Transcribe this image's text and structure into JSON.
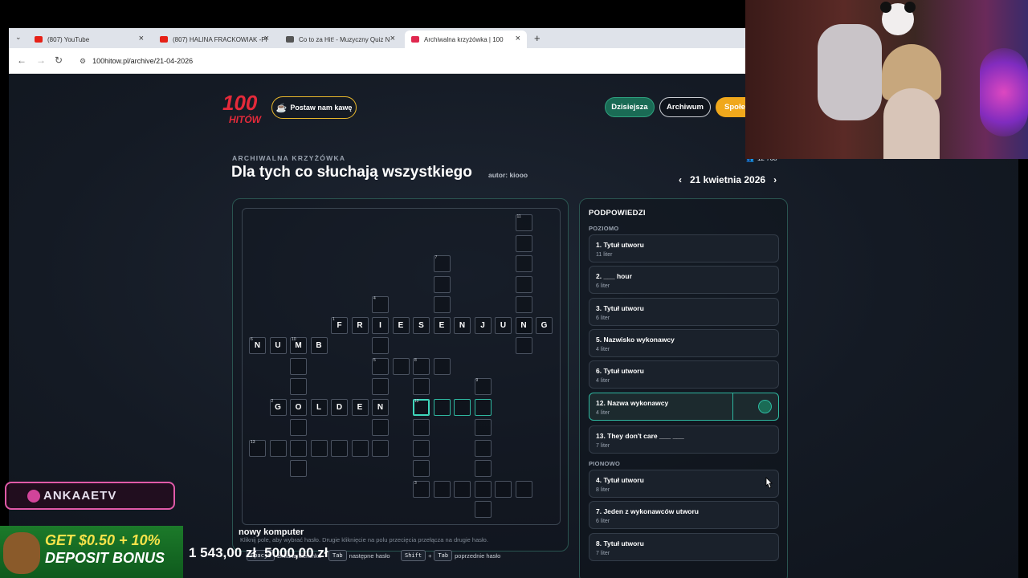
{
  "browser": {
    "tabs": [
      {
        "title": "(807) YouTube",
        "fav_color": "#e62117",
        "active": false
      },
      {
        "title": "(807) HALINA FRACKOWIAK -Pi",
        "fav_color": "#e62117",
        "active": false
      },
      {
        "title": "Co to za Hit! - Muzyczny Quiz N",
        "fav_color": "#555555",
        "active": false
      },
      {
        "title": "Archiwalna krzyżówka | 100",
        "fav_color": "#e0284f",
        "active": true
      }
    ],
    "url": "100hitow.pl/archive/21-04-2026"
  },
  "site": {
    "logo_text": "100 HITÓW",
    "coffee_button": "Postaw nam kawę",
    "nav": {
      "today": "Dzisiejsza",
      "archive": "Archiwum",
      "community": "Społe"
    },
    "kicker": "ARCHIWALNA KRZYŻÓWKA",
    "title": "Dla tych co słuchają wszystkiego",
    "author": "autor: kiooo",
    "date": "21 kwietnia 2026",
    "players_count": "12 768",
    "active_clue": "nowy komputer",
    "hint": "Kliknij pole, aby wybrać hasło. Drugie kliknięcie na polu przecięcia przełącza na drugie hasło.",
    "keyhelp": {
      "k1": "Spacja",
      "t1": "zmiana kierunku",
      "k2": "Tab",
      "t2": "następne hasło",
      "k3": "Shift",
      "plus": "+",
      "k4": "Tab",
      "t3": "poprzednie hasło"
    }
  },
  "crossword": {
    "cells": [
      {
        "r": 0,
        "c": 13,
        "n": "11"
      },
      {
        "r": 1,
        "c": 13
      },
      {
        "r": 2,
        "c": 13
      },
      {
        "r": 3,
        "c": 13
      },
      {
        "r": 4,
        "c": 13
      },
      {
        "r": 5,
        "c": 13
      },
      {
        "r": 2,
        "c": 9,
        "n": "7"
      },
      {
        "r": 3,
        "c": 9
      },
      {
        "r": 4,
        "c": 9
      },
      {
        "r": 4,
        "c": 6,
        "n": "4"
      },
      {
        "r": 5,
        "c": 4,
        "n": "1",
        "l": "F"
      },
      {
        "r": 5,
        "c": 5,
        "l": "R"
      },
      {
        "r": 5,
        "c": 6,
        "l": "I"
      },
      {
        "r": 5,
        "c": 7,
        "l": "E"
      },
      {
        "r": 5,
        "c": 8,
        "l": "S"
      },
      {
        "r": 5,
        "c": 9,
        "l": "E"
      },
      {
        "r": 5,
        "c": 10,
        "l": "N"
      },
      {
        "r": 5,
        "c": 11,
        "l": "J"
      },
      {
        "r": 5,
        "c": 12,
        "l": "U"
      },
      {
        "r": 5,
        "c": 13,
        "l": "N"
      },
      {
        "r": 5,
        "c": 14,
        "l": "G"
      },
      {
        "r": 6,
        "c": 0,
        "n": "6",
        "l": "N"
      },
      {
        "r": 6,
        "c": 1,
        "l": "U"
      },
      {
        "r": 6,
        "c": 2,
        "n": "10",
        "l": "M"
      },
      {
        "r": 6,
        "c": 3,
        "l": "B"
      },
      {
        "r": 6,
        "c": 6
      },
      {
        "r": 6,
        "c": 13
      },
      {
        "r": 7,
        "c": 2
      },
      {
        "r": 7,
        "c": 6,
        "n": "5"
      },
      {
        "r": 7,
        "c": 7
      },
      {
        "r": 7,
        "c": 8,
        "n": "8"
      },
      {
        "r": 7,
        "c": 9
      },
      {
        "r": 8,
        "c": 2
      },
      {
        "r": 8,
        "c": 6
      },
      {
        "r": 8,
        "c": 8
      },
      {
        "r": 8,
        "c": 11,
        "n": "9"
      },
      {
        "r": 9,
        "c": 1,
        "n": "2",
        "l": "G"
      },
      {
        "r": 9,
        "c": 2,
        "l": "O"
      },
      {
        "r": 9,
        "c": 3,
        "l": "L"
      },
      {
        "r": 9,
        "c": 4,
        "l": "D"
      },
      {
        "r": 9,
        "c": 5,
        "l": "E"
      },
      {
        "r": 9,
        "c": 6,
        "l": "N"
      },
      {
        "r": 9,
        "c": 8,
        "n": "12",
        "a": "cur"
      },
      {
        "r": 9,
        "c": 9,
        "a": "on"
      },
      {
        "r": 9,
        "c": 10,
        "a": "on"
      },
      {
        "r": 9,
        "c": 11,
        "a": "on"
      },
      {
        "r": 10,
        "c": 2
      },
      {
        "r": 10,
        "c": 6
      },
      {
        "r": 10,
        "c": 8
      },
      {
        "r": 10,
        "c": 11
      },
      {
        "r": 11,
        "c": 0,
        "n": "13"
      },
      {
        "r": 11,
        "c": 1
      },
      {
        "r": 11,
        "c": 2
      },
      {
        "r": 11,
        "c": 3
      },
      {
        "r": 11,
        "c": 4
      },
      {
        "r": 11,
        "c": 5
      },
      {
        "r": 11,
        "c": 6
      },
      {
        "r": 11,
        "c": 8
      },
      {
        "r": 11,
        "c": 11
      },
      {
        "r": 12,
        "c": 2
      },
      {
        "r": 12,
        "c": 8
      },
      {
        "r": 12,
        "c": 11
      },
      {
        "r": 13,
        "c": 8,
        "n": "3"
      },
      {
        "r": 13,
        "c": 9
      },
      {
        "r": 13,
        "c": 10
      },
      {
        "r": 13,
        "c": 11
      },
      {
        "r": 13,
        "c": 12
      },
      {
        "r": 13,
        "c": 13
      },
      {
        "r": 14,
        "c": 11
      }
    ]
  },
  "clues": {
    "title": "PODPOWIEDZI",
    "across_label": "POZIOMO",
    "down_label": "PIONOWO",
    "across": [
      {
        "title": "1. Tytuł utworu",
        "sub": "11 liter"
      },
      {
        "title": "2. ___ hour",
        "sub": "6 liter"
      },
      {
        "title": "3. Tytuł utworu",
        "sub": "6 liter"
      },
      {
        "title": "5. Nazwisko wykonawcy",
        "sub": "4 liter"
      },
      {
        "title": "6. Tytuł utworu",
        "sub": "4 liter"
      },
      {
        "title": "12. Nazwa wykonawcy",
        "sub": "4 liter",
        "selected": true
      },
      {
        "title": "13. They don't care ___ ___",
        "sub": "7 liter"
      }
    ],
    "down": [
      {
        "title": "4. Tytuł utworu",
        "sub": "8 liter"
      },
      {
        "title": "7. Jeden z wykonawców utworu",
        "sub": "6 liter"
      },
      {
        "title": "8. Tytuł utworu",
        "sub": "7 liter"
      }
    ]
  },
  "overlay": {
    "social": "ANKAAETV",
    "promo_line1": "GET $0.50 + 10%",
    "promo_line2": "DEPOSIT BONUS",
    "balance1": "1 543,00 zł",
    "balance2": "5000,00 zł"
  }
}
